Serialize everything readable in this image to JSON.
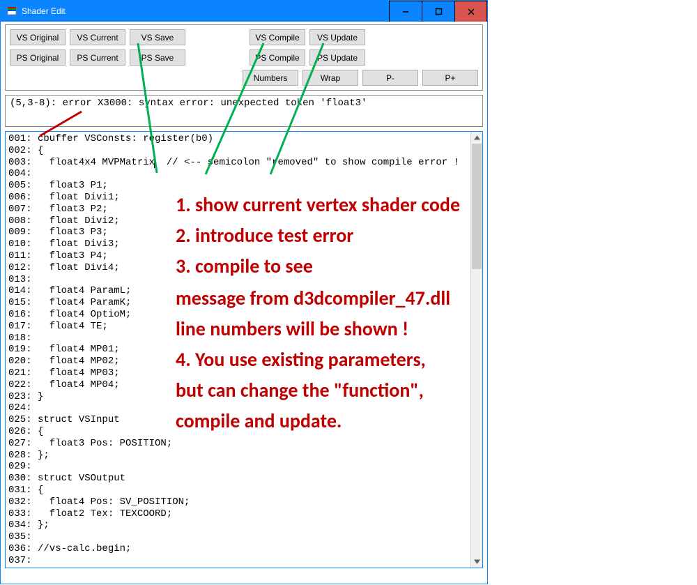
{
  "window": {
    "title": "Shader Edit"
  },
  "toolbar": {
    "row1": {
      "vs_original": "VS Original",
      "vs_current": "VS Current",
      "vs_save": "VS Save",
      "vs_compile": "VS Compile",
      "vs_update": "VS Update"
    },
    "row2": {
      "ps_original": "PS Original",
      "ps_current": "PS Current",
      "ps_save": "PS Save",
      "ps_compile": "PS Compile",
      "ps_update": "PS Update"
    },
    "row3": {
      "numbers": "Numbers",
      "wrap": "Wrap",
      "p_minus": "P-",
      "p_plus": "P+"
    }
  },
  "error_text": "(5,3-8): error X3000: syntax error: unexpected token 'float3'",
  "code_text": "001: cbuffer VSConsts: register(b0)\n002: {\n003:   float4x4 MVPMatrix|  // <-- semicolon \"removed\" to show compile error !\n004:\n005:   float3 P1;\n006:   float Divi1;\n007:   float3 P2;\n008:   float Divi2;\n009:   float3 P3;\n010:   float Divi3;\n011:   float3 P4;\n012:   float Divi4;\n013:\n014:   float4 ParamL;\n015:   float4 ParamK;\n016:   float4 OptioM;\n017:   float4 TE;\n018:\n019:   float4 MP01;\n020:   float4 MP02;\n021:   float4 MP03;\n022:   float4 MP04;\n023: }\n024:\n025: struct VSInput\n026: {\n027:   float3 Pos: POSITION;\n028: };\n029:\n030: struct VSOutput\n031: {\n032:   float4 Pos: SV_POSITION;\n033:   float2 Tex: TEXCOORD;\n034: };\n035:\n036: //vs-calc.begin;\n037:",
  "annotations": {
    "n1": "1. show current vertex shader code",
    "n2": "2. introduce test error",
    "n3": "3. compile to see",
    "n3b": "    message from d3dcompiler_47.dll",
    "n3c": "    line numbers will be shown !",
    "n4": "4. You use existing parameters,",
    "n4b": "    but can change the \"function\",",
    "n4c": "    compile and update."
  },
  "colors": {
    "accent": "#0a84ff",
    "annotation": "#c00000",
    "green_line": "#00b050"
  }
}
